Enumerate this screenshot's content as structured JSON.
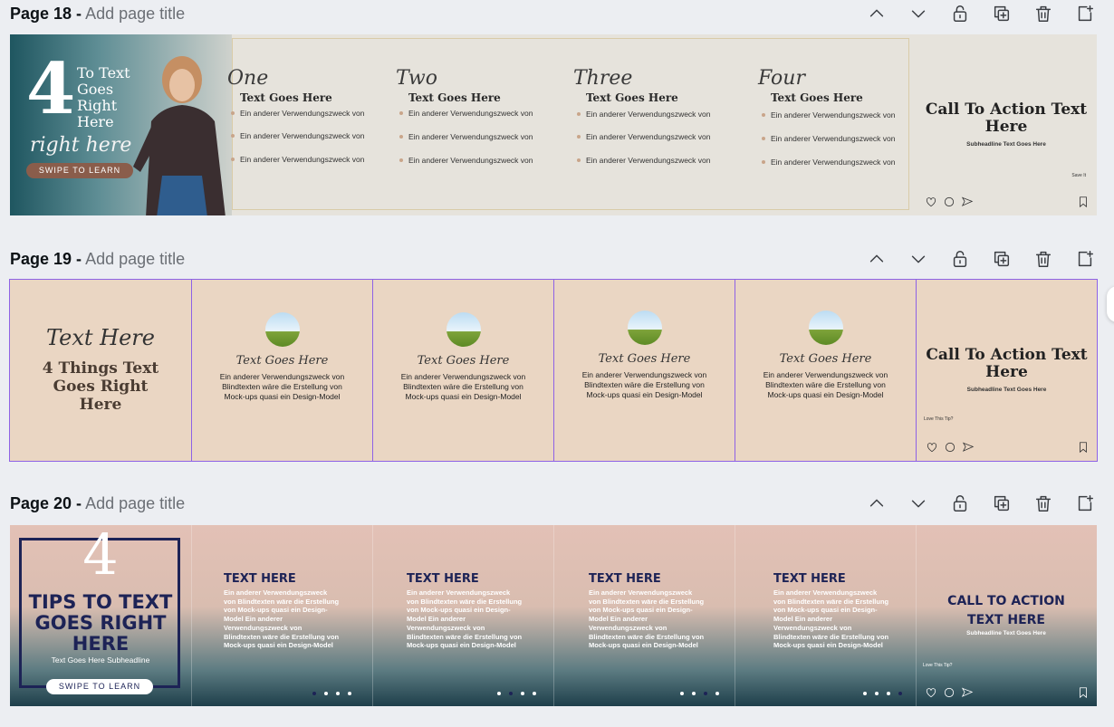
{
  "toolbar_icons": [
    "chevron-up-icon",
    "chevron-down-icon",
    "lock-icon",
    "duplicate-icon",
    "trash-icon",
    "add-page-icon"
  ],
  "colors": {
    "accent_purple": "#8e62e6",
    "navy": "#1d2356",
    "teal": "#1f5660"
  },
  "pages": [
    {
      "number": "Page 18 -",
      "title_placeholder": "Add page title"
    },
    {
      "number": "Page 19 -",
      "title_placeholder": "Add page title"
    },
    {
      "number": "Page 20 -",
      "title_placeholder": "Add page title"
    }
  ],
  "p18": {
    "big": "4",
    "lines": [
      "To Text",
      "Goes",
      "Right",
      "Here"
    ],
    "script": "right here",
    "button": "SWIPE TO LEARN",
    "steps": [
      {
        "n": "One",
        "h": "Text Goes Here"
      },
      {
        "n": "Two",
        "h": "Text Goes Here"
      },
      {
        "n": "Three",
        "h": "Text Goes Here"
      },
      {
        "n": "Four",
        "h": "Text Goes Here"
      }
    ],
    "bullet": "Ein anderer Verwendungszweck von",
    "cta": "Call To Action Text Here",
    "sub": "Subheadline Text Goes Here",
    "save": "Save It"
  },
  "p19": {
    "script": "Text Here",
    "headline": "4 Things Text Goes Right Here",
    "card_title": "Text Goes Here",
    "card_body": "Ein anderer Verwendungszweck von Blindtexten wäre die Erstellung von Mock-ups quasi ein Design-Model",
    "cta": "Call To Action Text Here",
    "sub": "Subheadline Text Goes Here",
    "love": "Love This Tip?"
  },
  "p20": {
    "big": "4",
    "headline": "TIPS TO TEXT GOES RIGHT HERE",
    "sub": "Text Goes Here Subheadline",
    "button": "SWIPE TO LEARN",
    "card_title": "TEXT HERE",
    "card_body": "Ein anderer Verwendungszweck von Blindtexten wäre die Erstellung von Mock-ups quasi ein Design-Model Ein anderer Verwendungszweck von Blindtexten wäre die Erstellung von Mock-ups quasi ein Design-Model",
    "cta": "CALL TO ACTION TEXT HERE",
    "cta_sub": "Subheadline Text Goes Here",
    "love": "Love This Tip?"
  }
}
